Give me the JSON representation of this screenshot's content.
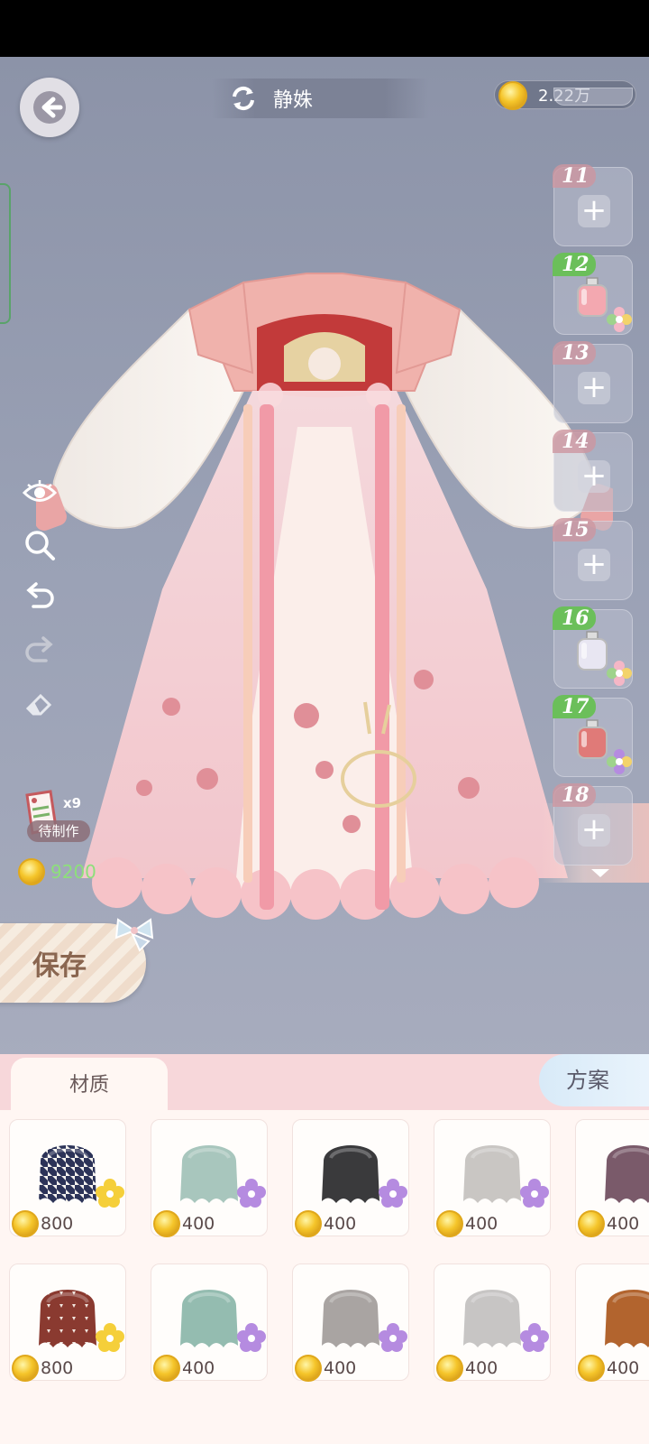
{
  "header": {
    "title": "静姝",
    "currency": "2.22万"
  },
  "toolbar": {
    "tools": [
      "eye-icon",
      "zoom-icon",
      "undo-icon",
      "redo-icon",
      "eraser-icon"
    ]
  },
  "slots": [
    {
      "num": "11",
      "state": "empty"
    },
    {
      "num": "12",
      "state": "filled",
      "color": "#f3a8b0"
    },
    {
      "num": "13",
      "state": "empty"
    },
    {
      "num": "14",
      "state": "empty"
    },
    {
      "num": "15",
      "state": "empty"
    },
    {
      "num": "16",
      "state": "filled",
      "color": "#e8e6f2"
    },
    {
      "num": "17",
      "state": "filled",
      "color": "#e07a78"
    },
    {
      "num": "18",
      "state": "empty"
    }
  ],
  "pending": {
    "count": "x9",
    "label": "待制作"
  },
  "cost": "9200",
  "save_label": "保存",
  "panel": {
    "tab_material": "材质",
    "tab_plan": "方案"
  },
  "materials": [
    {
      "price": "800",
      "color": "#2c3358",
      "pattern": "houndstooth",
      "gem": "yellow"
    },
    {
      "price": "400",
      "color": "#a8c6bd",
      "gem": "purple"
    },
    {
      "price": "400",
      "color": "#3a3a3c",
      "gem": "purple"
    },
    {
      "price": "400",
      "color": "#c9c6c3",
      "gem": "purple"
    },
    {
      "price": "400",
      "color": "#7a5a6a",
      "gem": "purple"
    },
    {
      "price": "800",
      "color": "#8a3a30",
      "pattern": "triangles",
      "gem": "yellow"
    },
    {
      "price": "400",
      "color": "#94bcb0",
      "gem": "purple"
    },
    {
      "price": "400",
      "color": "#a9a4a2",
      "gem": "purple"
    },
    {
      "price": "400",
      "color": "#c7c5c4",
      "gem": "purple"
    },
    {
      "price": "400",
      "color": "#b2642e",
      "gem": "purple"
    }
  ]
}
